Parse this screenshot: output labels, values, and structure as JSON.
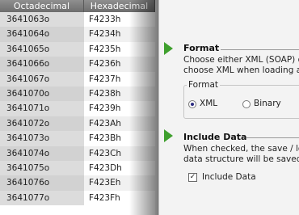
{
  "grid": {
    "columns": [
      "Octadecimal",
      "Hexadecimal"
    ],
    "rows": [
      [
        "3641063o",
        "F4233h"
      ],
      [
        "3641064o",
        "F4234h"
      ],
      [
        "3641065o",
        "F4235h"
      ],
      [
        "3641066o",
        "F4236h"
      ],
      [
        "3641067o",
        "F4237h"
      ],
      [
        "3641070o",
        "F4238h"
      ],
      [
        "3641071o",
        "F4239h"
      ],
      [
        "3641072o",
        "F423Ah"
      ],
      [
        "3641073o",
        "F423Bh"
      ],
      [
        "3641074o",
        "F423Ch"
      ],
      [
        "3641075o",
        "F423Dh"
      ],
      [
        "3641076o",
        "F423Eh"
      ],
      [
        "3641077o",
        "F423Fh"
      ]
    ]
  },
  "format": {
    "title": "Format",
    "desc_line1": "Choose either XML (SOAP) or B",
    "desc_line2": "choose XML when loading and",
    "group_label": "Format",
    "options": [
      {
        "label": "XML",
        "selected": true
      },
      {
        "label": "Binary",
        "selected": false
      }
    ]
  },
  "include": {
    "title": "Include Data",
    "desc_line1": "When checked, the save / load",
    "desc_line2": "data structure will be saved (w",
    "checkbox_label": "Include Data",
    "checked": true
  },
  "colors": {
    "accent_arrow": "#3fa02e",
    "header_bg": "#7d7d7d"
  }
}
